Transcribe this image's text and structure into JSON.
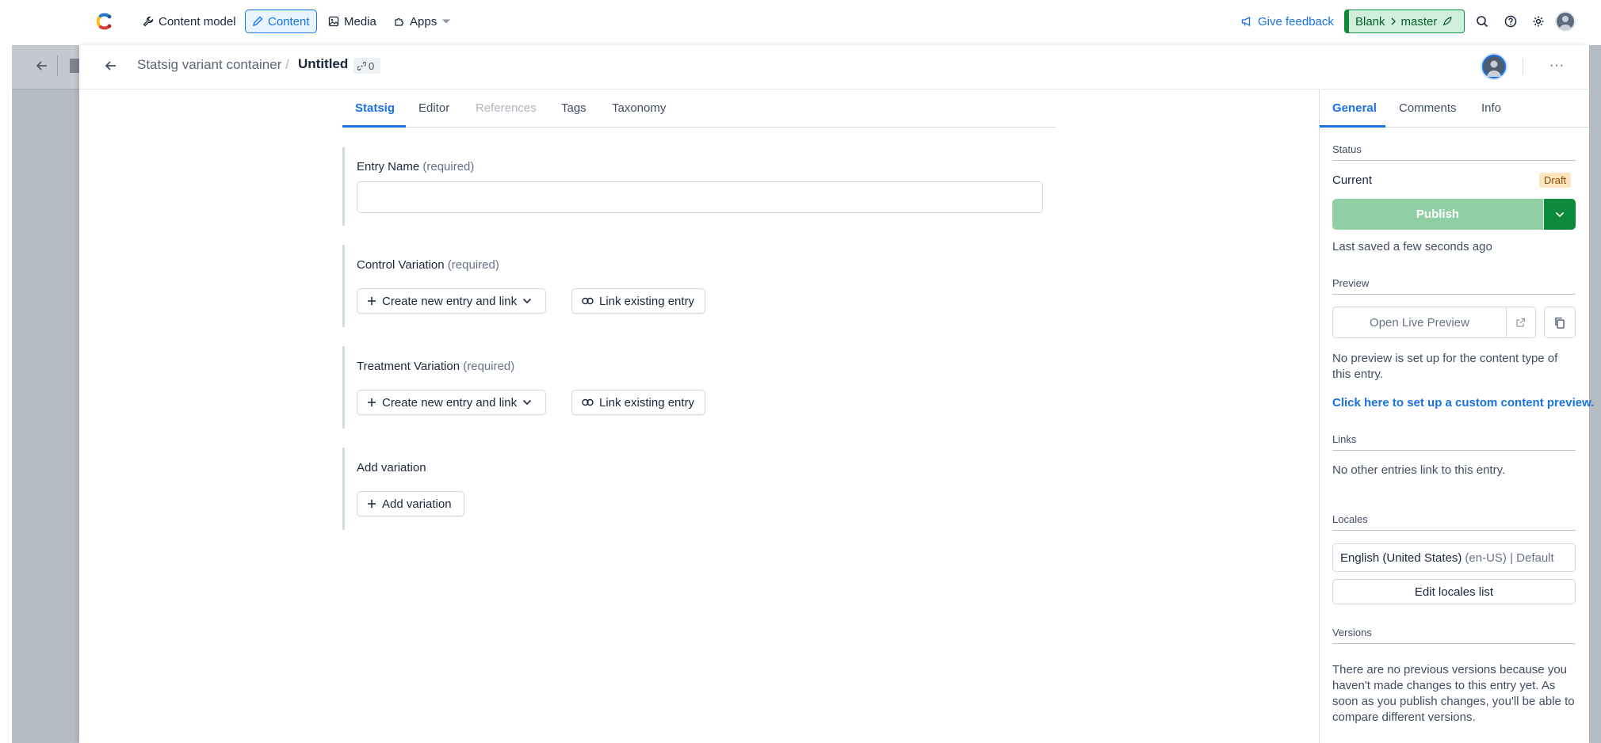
{
  "topnav": {
    "logo": "contentful-logo",
    "items": [
      {
        "label": "Content model",
        "icon": "wrench-icon"
      },
      {
        "label": "Content",
        "icon": "pen-icon",
        "active": true
      },
      {
        "label": "Media",
        "icon": "image-icon"
      },
      {
        "label": "Apps",
        "icon": "puzzle-icon"
      }
    ],
    "feedback_label": "Give feedback",
    "env": {
      "space": "Blank",
      "environment": "master"
    }
  },
  "entry": {
    "breadcrumb_type": "Statsig variant container",
    "breadcrumb_separator": "/",
    "title": "Untitled",
    "link_count": "0",
    "more_label": "···"
  },
  "tabs": [
    {
      "label": "Statsig",
      "state": "active"
    },
    {
      "label": "Editor",
      "state": "normal"
    },
    {
      "label": "References",
      "state": "disabled"
    },
    {
      "label": "Tags",
      "state": "normal"
    },
    {
      "label": "Taxonomy",
      "state": "normal"
    }
  ],
  "fields": {
    "entry_name": {
      "label": "Entry Name",
      "required": "(required)",
      "value": ""
    },
    "control": {
      "label": "Control Variation",
      "required": "(required)",
      "create_label": "Create new entry and link",
      "link_label": "Link existing entry"
    },
    "treatment": {
      "label": "Treatment Variation",
      "required": "(required)",
      "create_label": "Create new entry and link",
      "link_label": "Link existing entry"
    },
    "add_variation": {
      "label": "Add variation",
      "button_label": "Add variation"
    }
  },
  "sidebar": {
    "tabs": [
      {
        "label": "General",
        "active": true
      },
      {
        "label": "Comments"
      },
      {
        "label": "Info"
      }
    ],
    "status": {
      "title": "Status",
      "current_label": "Current",
      "badge": "Draft",
      "publish_label": "Publish",
      "saved_text": "Last saved a few seconds ago"
    },
    "preview": {
      "title": "Preview",
      "button_label": "Open Live Preview",
      "note": "No preview is set up for the content type of this entry.",
      "link": "Click here to set up a custom content preview."
    },
    "links": {
      "title": "Links",
      "text": "No other entries link to this entry."
    },
    "locales": {
      "title": "Locales",
      "locale_name": "English (United States)",
      "locale_meta": "(en-US) | Default",
      "edit_label": "Edit locales list"
    },
    "versions": {
      "title": "Versions",
      "text": "There are no previous versions because you haven't made changes to this entry yet. As soon as you publish changes, you'll be able to compare different versions."
    }
  },
  "colors": {
    "accent": "#1872e5",
    "publish_disabled": "#8fcfa4",
    "publish_dropdown": "#0e8a3c",
    "draft_badge": "#fde5c0",
    "env_badge": "#cfeedb"
  }
}
